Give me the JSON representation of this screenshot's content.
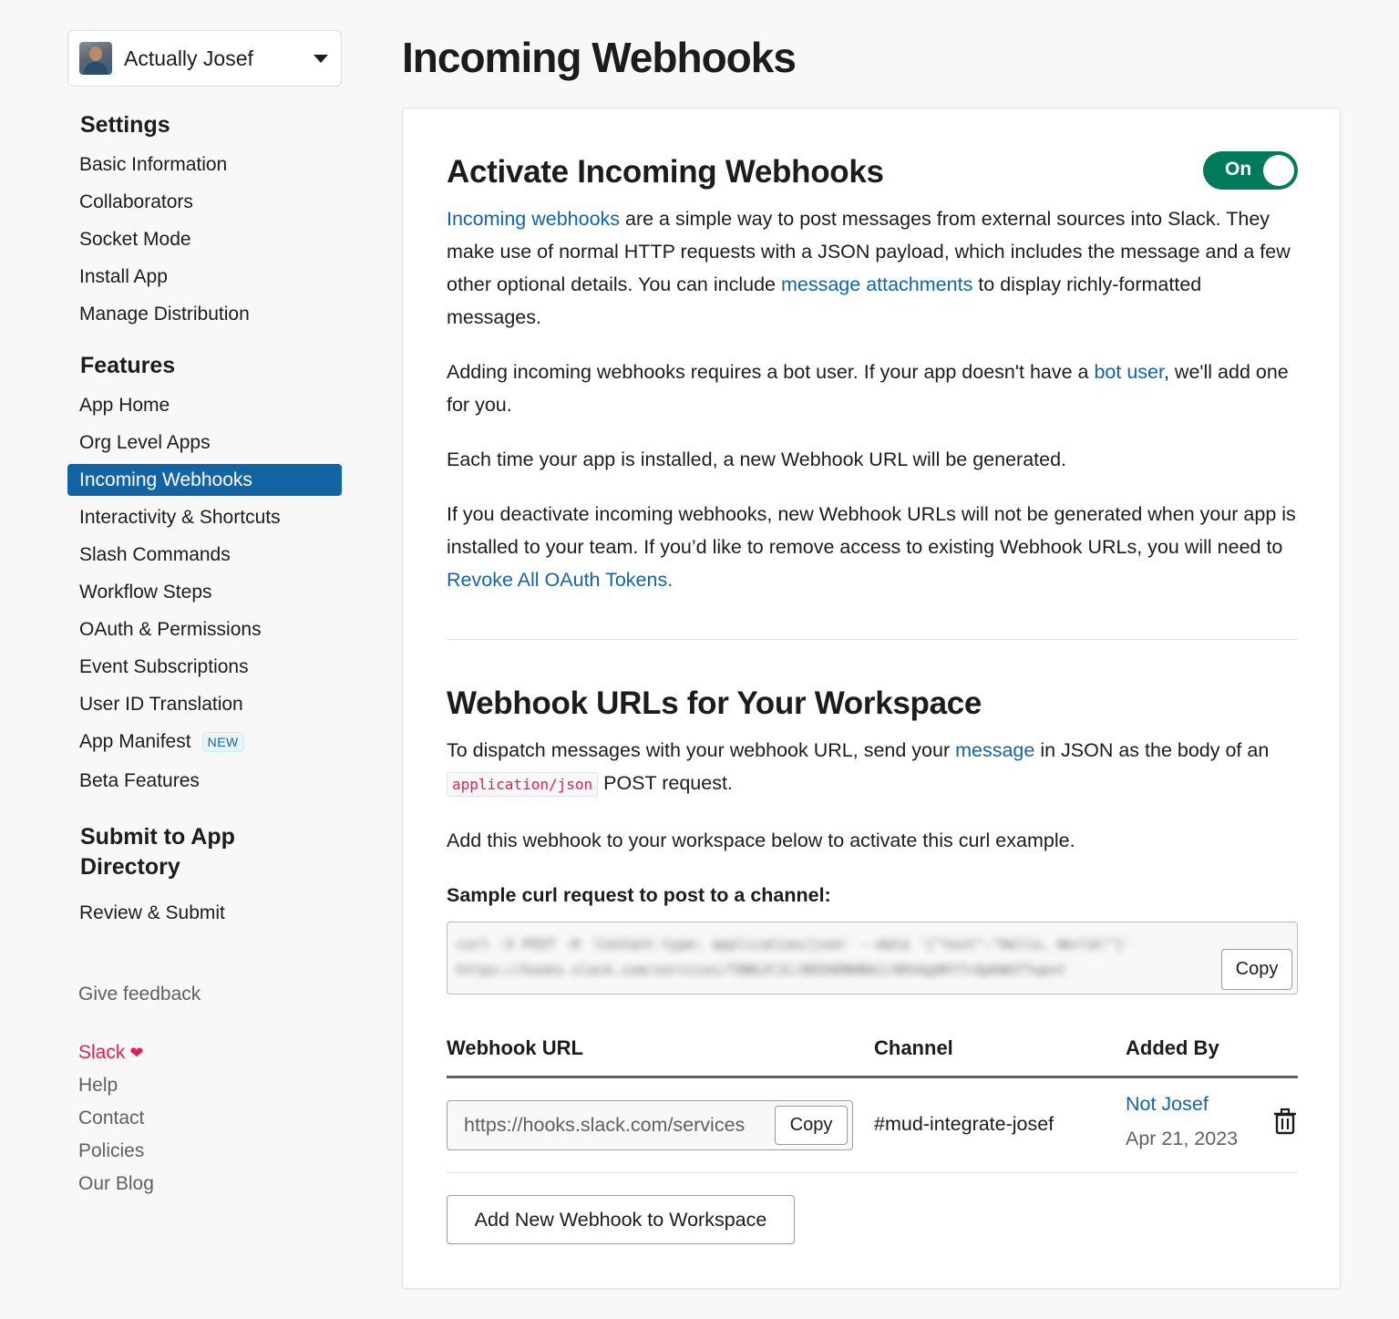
{
  "sidebar": {
    "app_name": "Actually Josef",
    "sections": {
      "settings": {
        "heading": "Settings",
        "items": [
          "Basic Information",
          "Collaborators",
          "Socket Mode",
          "Install App",
          "Manage Distribution"
        ]
      },
      "features": {
        "heading": "Features",
        "items": [
          "App Home",
          "Org Level Apps",
          "Incoming Webhooks",
          "Interactivity & Shortcuts",
          "Slash Commands",
          "Workflow Steps",
          "OAuth & Permissions",
          "Event Subscriptions",
          "User ID Translation",
          "App Manifest",
          "Beta Features"
        ],
        "active": "Incoming Webhooks",
        "new_badge": "NEW"
      },
      "submit": {
        "heading_line1": "Submit to App",
        "heading_line2": "Directory",
        "items": [
          "Review & Submit"
        ]
      }
    },
    "give_feedback": "Give feedback",
    "footer_links": [
      "Slack",
      "Help",
      "Contact",
      "Policies",
      "Our Blog"
    ]
  },
  "page": {
    "title": "Incoming Webhooks"
  },
  "activate": {
    "title": "Activate Incoming Webhooks",
    "toggle_label": "On",
    "toggle_on": true,
    "p1": {
      "link1": "Incoming webhooks",
      "text1": " are a simple way to post messages from external sources into Slack. They make use of normal HTTP requests with a JSON payload, which includes the message and a few other optional details. You can include ",
      "link2": "message attachments",
      "text2": " to display richly-formatted messages."
    },
    "p2": {
      "text1": "Adding incoming webhooks requires a bot user. If your app doesn't have a ",
      "link": "bot user",
      "text2": ", we'll add one for you."
    },
    "p3": "Each time your app is installed, a new Webhook URL will be generated.",
    "p4": {
      "text": "If you deactivate incoming webhooks, new Webhook URLs will not be generated when your app is installed to your team. If you’d like to remove access to existing Webhook URLs, you will need to ",
      "link": "Revoke All OAuth Tokens."
    }
  },
  "workspace": {
    "title": "Webhook URLs for Your Workspace",
    "p1": {
      "text1": "To dispatch messages with your webhook URL, send your ",
      "link": "message",
      "text2": " in JSON as the body of an ",
      "code": "application/json",
      "text3": " POST request."
    },
    "p2": "Add this webhook to your workspace below to activate this curl example.",
    "curl_label": "Sample curl request to post to a channel:",
    "curl_line1": "curl -X POST -H 'Content-type: application/json' --data '{\"text\":\"Hello, World!\"}'",
    "curl_line2": "https://hooks.slack.com/services/T0BGJC1C/B05HDNHBAJ/OKhOg8KY7cQpKWUfTwpnt",
    "copy_label": "Copy",
    "table": {
      "headers": [
        "Webhook URL",
        "Channel",
        "Added By"
      ],
      "rows": [
        {
          "url": "https://hooks.slack.com/services",
          "channel": "#mud-integrate-josef",
          "added_by": "Not Josef",
          "date": "Apr 21, 2023"
        }
      ]
    },
    "add_button": "Add New Webhook to Workspace"
  },
  "colors": {
    "accent": "#1264a3",
    "toggle_on": "#007a5a",
    "slack_pink": "#e01e5a"
  }
}
